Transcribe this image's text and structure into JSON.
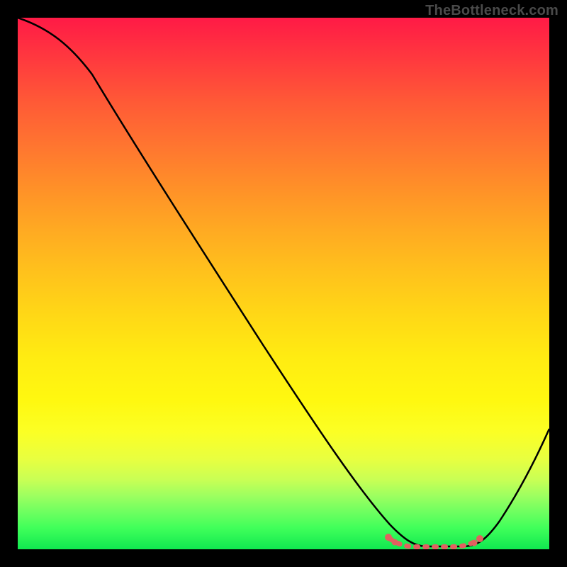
{
  "watermark": "TheBottleneck.com",
  "chart_data": {
    "type": "line",
    "title": "",
    "xlabel": "",
    "ylabel": "",
    "xlim": [
      0,
      100
    ],
    "ylim": [
      0,
      100
    ],
    "series": [
      {
        "name": "curve",
        "x": [
          0,
          8,
          15,
          22,
          30,
          38,
          46,
          54,
          62,
          68,
          72,
          76,
          80,
          84,
          88,
          92,
          96,
          100
        ],
        "values": [
          100,
          97,
          91,
          82,
          71,
          60,
          49,
          38,
          27,
          16,
          8,
          3,
          1,
          1,
          2,
          6,
          14,
          24
        ]
      }
    ],
    "highlight_region": {
      "x_start": 70,
      "x_end": 88,
      "color": "#e86a6a"
    }
  }
}
